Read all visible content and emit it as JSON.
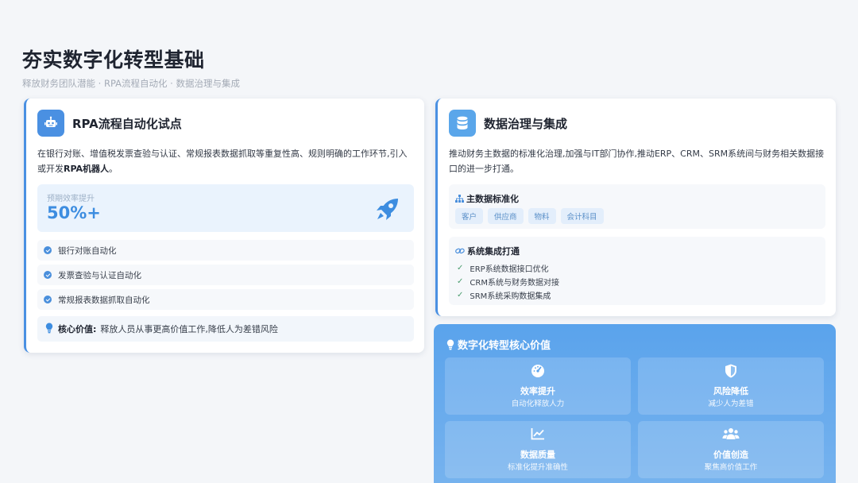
{
  "header": {
    "title": "夯实数字化转型基础",
    "subtitle": "释放财务团队潜能 · RPA流程自动化 · 数据治理与集成"
  },
  "rpa_card": {
    "title": "RPA流程自动化试点",
    "desc_text": "在银行对账、增值税发票查验与认证、常规报表数据抓取等重复性高、规则明确的工作环节,引入或开发",
    "desc_bold": "RPA机器人",
    "desc_end": "。",
    "metric_label": "预期效率提升",
    "metric_value": "50%+",
    "items": [
      {
        "label": "银行对账自动化"
      },
      {
        "label": "发票查验与认证自动化"
      },
      {
        "label": "常规报表数据抓取自动化"
      }
    ],
    "core_label": "核心价值:",
    "core_text": "释放人员从事更高价值工作,降低人为差错风险",
    "icon": "robot-icon",
    "accent": "#4a90e2"
  },
  "data_card": {
    "title": "数据治理与集成",
    "desc": "推动财务主数据的标准化治理,加强与IT部门协作,推动ERP、CRM、SRM系统间与财务相关数据接口的进一步打通。",
    "master_title": "主数据标准化",
    "tags": [
      "客户",
      "供应商",
      "物料",
      "会计科目"
    ],
    "integration_title": "系统集成打通",
    "integration_items": [
      "ERP系统数据接口优化",
      "CRM系统与财务数据对接",
      "SRM系统采购数据集成"
    ],
    "icon": "database-icon"
  },
  "value_panel": {
    "title": "数字化转型核心价值",
    "cards": [
      {
        "title": "效率提升",
        "sub": "自动化释放人力",
        "icon": "gauge-icon"
      },
      {
        "title": "风险降低",
        "sub": "减少人为差错",
        "icon": "shield-icon"
      },
      {
        "title": "数据质量",
        "sub": "标准化提升准确性",
        "icon": "chart-line-icon"
      },
      {
        "title": "价值创造",
        "sub": "聚焦高价值工作",
        "icon": "users-icon"
      }
    ],
    "gradient_top": "#5aa3ec",
    "gradient_bottom": "#77b3ee"
  }
}
